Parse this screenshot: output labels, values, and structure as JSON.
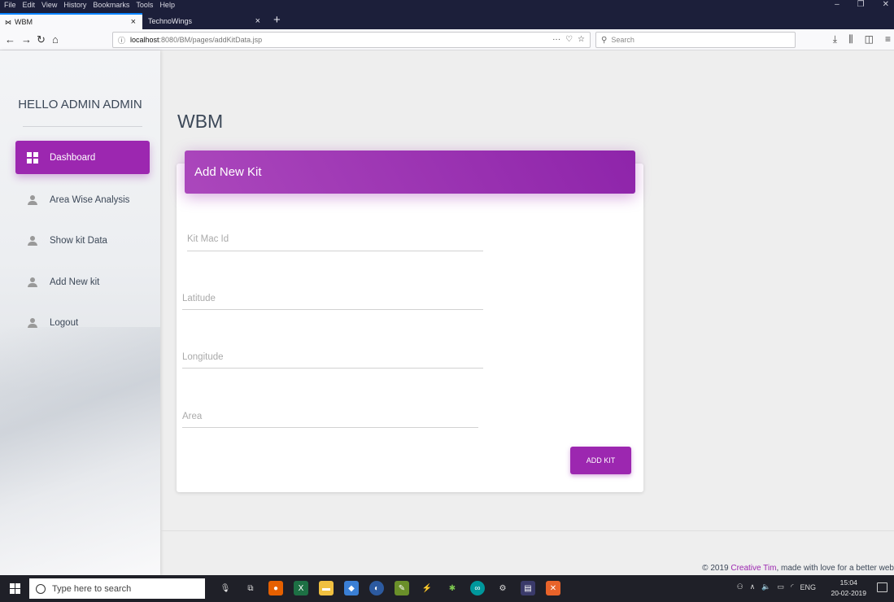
{
  "browser": {
    "menu": [
      "File",
      "Edit",
      "View",
      "History",
      "Bookmarks",
      "Tools",
      "Help"
    ],
    "tabs": [
      {
        "label": "WBM",
        "icon": "wbm-favicon"
      },
      {
        "label": "TechnoWings"
      }
    ],
    "url_host": "localhost",
    "url_path": ":8080/BM/pages/addKitData.jsp",
    "search_placeholder": "Search",
    "window_controls": {
      "minimize": "–",
      "restore": "❐",
      "close": "✕"
    }
  },
  "sidebar": {
    "brand": "HELLO ADMIN ADMIN",
    "items": [
      {
        "label": "Dashboard",
        "icon": "dashboard-icon",
        "active": true
      },
      {
        "label": "Area Wise Analysis",
        "icon": "person-icon"
      },
      {
        "label": "Show kit Data",
        "icon": "person-icon"
      },
      {
        "label": "Add New kit",
        "icon": "person-icon"
      },
      {
        "label": "Logout",
        "icon": "person-icon"
      }
    ]
  },
  "main": {
    "title": "WBM",
    "card_title": "Add New Kit",
    "fields": {
      "kit_mac_id": "Kit Mac Id",
      "latitude": "Latitude",
      "longitude": "Longitude",
      "area": "Area"
    },
    "submit_label": "ADD KIT"
  },
  "footer": {
    "prefix": "© 2019 ",
    "link": "Creative Tim",
    "suffix": ", made with love for a better web"
  },
  "taskbar": {
    "search_placeholder": "Type here to search",
    "tray_lang": "ENG",
    "time": "15:04",
    "date": "20-02-2019"
  },
  "colors": {
    "accent": "#9c27b0",
    "titlebar": "#1c1f3a",
    "taskbar": "#1f2028"
  }
}
